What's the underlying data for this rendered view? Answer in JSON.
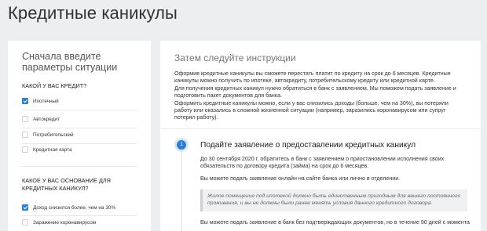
{
  "page": {
    "title": "Кредитные каникулы"
  },
  "left": {
    "heading": "Сначала введите параметры ситуации",
    "q1": {
      "title": "КАКОЙ У ВАС КРЕДИТ?",
      "options": [
        {
          "label": "Ипотечный",
          "checked": true
        },
        {
          "label": "Автокредит",
          "checked": false
        },
        {
          "label": "Потребительский",
          "checked": false
        },
        {
          "label": "Кредитная карта",
          "checked": false
        }
      ]
    },
    "q2": {
      "title": "КАКОЕ У ВАС ОСНОВАНИЕ ДЛЯ КРЕДИТНЫХ КАНИКУЛ?",
      "options": [
        {
          "label": "Доход снизился более, чем на 30%",
          "checked": true
        },
        {
          "label": "Заражение коронавирусом",
          "checked": false
        }
      ]
    }
  },
  "right": {
    "heading": "Затем следуйте инструкции",
    "intro": [
      "Оформив кредитные каникулы вы сможете перестать платит по кредиту на срок до 6 месяцев. Кредитные каникулы можно получить по ипотеке, автокредиту, потребительскому кредиту или кредитной карте.",
      "Для получения кредитных каникул нужно обратиться в банк с заявлением. Мы поможем подать заявление и подготовить пакет документов для банка.",
      "Оформить кредитные каникулы можно, если у вас снизились доходы (больше, чем на 30%), вы потеряли работу или оказались в сложной жизненной ситуации (например, заразились коронавирусом или супруг потерял работу)."
    ],
    "step": {
      "number": "1",
      "title": "Подайте заявление о предоставлении кредитных каникул",
      "text1": "До 30 сентября 2020 г. обратитесь в банк с заявлением о приостановлении исполнения своих обязательств по договору кредита (займа) на срок до 6 месяцев.",
      "text2": "Вы можете подать заявление онлайн на сайте банка или лично в отделении.",
      "note": "Жилое помещение под ипотекой должно быть единственным пригодным для вашего постоянного проживания, и вы не должны были ранее менять условия данного кредитного договора.",
      "text3": "Вы можете подать заявление в банк без подтверждающих документов, но в течение 90 дней с момента"
    }
  }
}
